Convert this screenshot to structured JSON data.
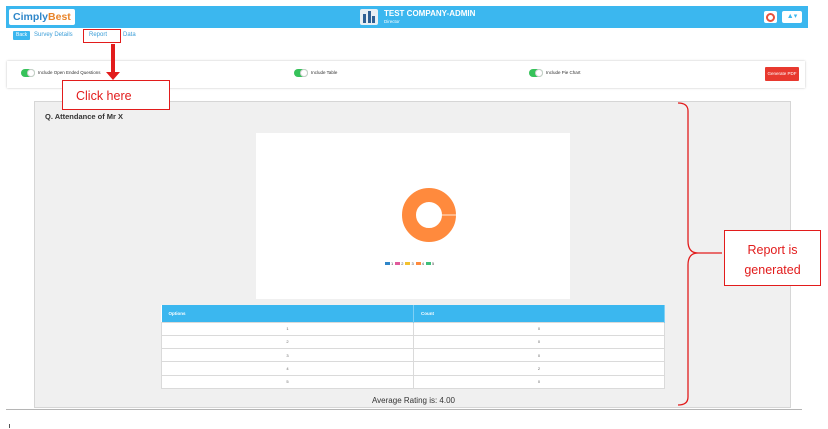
{
  "header": {
    "logo_part1": "Cimply",
    "logo_part2": "Best",
    "company_name": "TEST COMPANY-ADMIN",
    "company_role": "Director",
    "user_menu_label": "▲▾",
    "brand_color": "#3bb7ef"
  },
  "nav": {
    "back_label": "Back",
    "survey_details_label": "Survey Details",
    "report_label": "Report",
    "data_label": "Data"
  },
  "options": {
    "open_ended_label": "Include Open Ended Questions",
    "table_label": "Include Table",
    "pie_label": "Include Pie Chart",
    "generate_label": "Generate PDF"
  },
  "annotations": {
    "click_here": "Click here",
    "report_line1": "Report is",
    "report_line2": "generated"
  },
  "report": {
    "question": "Q. Attendance of Mr X",
    "average": "Average Rating is: 4.00"
  },
  "chart_data": {
    "type": "pie",
    "categories": [
      "1",
      "2",
      "3",
      "4",
      "5"
    ],
    "values": [
      0,
      0,
      0,
      2,
      0
    ],
    "colors": [
      "#2e86c9",
      "#e05a9b",
      "#f2c12e",
      "#ff8a3d",
      "#3fbf7a"
    ],
    "donut": true,
    "legend": "bottom"
  },
  "table": {
    "headers": [
      "Options",
      "Count"
    ],
    "rows": [
      [
        "1",
        "0"
      ],
      [
        "2",
        "0"
      ],
      [
        "3",
        "0"
      ],
      [
        "4",
        "2"
      ],
      [
        "5",
        "0"
      ]
    ]
  }
}
